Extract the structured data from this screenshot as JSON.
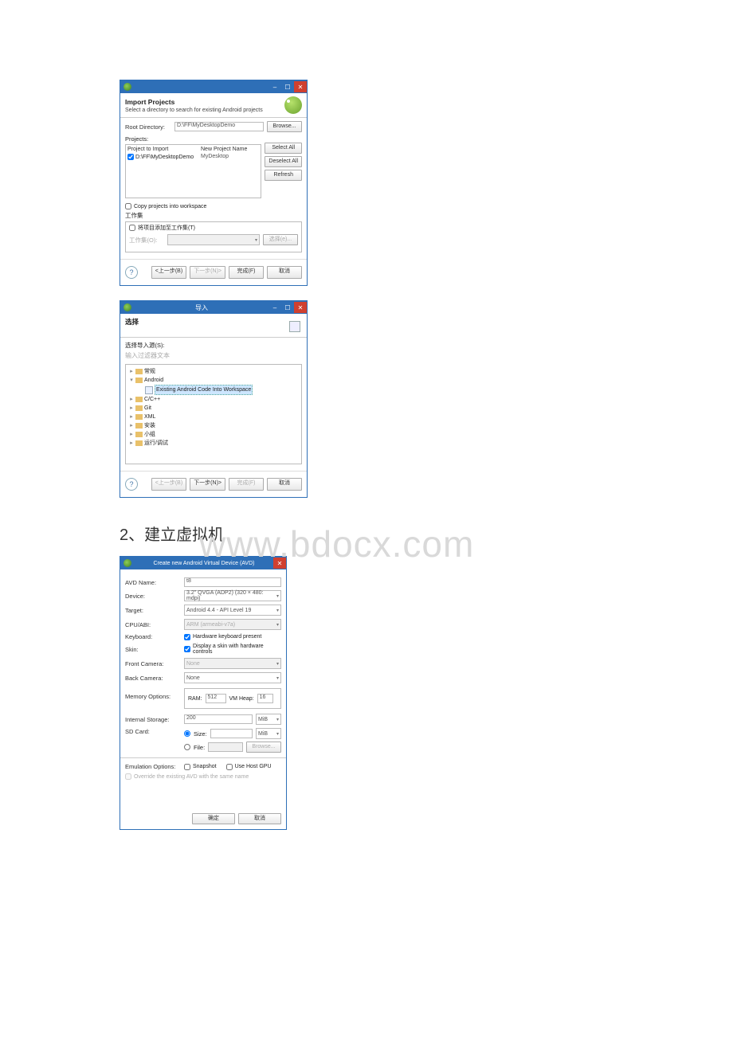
{
  "watermark": "www.bdocx.com",
  "body_text": "2、建立虚拟机",
  "win1": {
    "title": "",
    "header_title": "Import Projects",
    "header_sub": "Select a directory to search for existing Android projects",
    "root_dir_label": "Root Directory:",
    "root_dir_value": "D:\\FF\\MyDesktopDemo",
    "browse": "Browse...",
    "projects_label": "Projects:",
    "col1": "Project to Import",
    "col2": "New Project Name",
    "proj_path": "D:\\FF\\MyDesktopDemo",
    "proj_name": "MyDesktop",
    "select_all": "Select All",
    "deselect_all": "Deselect All",
    "refresh": "Refresh",
    "copy_label": "Copy projects into workspace",
    "ws_label": "工作集",
    "ws_chk": "将项目添加至工作集(T)",
    "ws_field_label": "工作集(O):",
    "ws_select_btn": "选择(e)...",
    "btn_back": "<上一步(B)",
    "btn_next": "下一步(N)>",
    "btn_finish": "完成(F)",
    "btn_cancel": "取消"
  },
  "win2": {
    "title": "导入",
    "header_title": "选择",
    "src_label": "选择导入源(S):",
    "filter_placeholder": "输入过滤器文本",
    "tree": {
      "n0": "常规",
      "n1": "Android",
      "n1a": "Existing Android Code Into Workspace",
      "n2": "C/C++",
      "n3": "Git",
      "n4": "XML",
      "n5": "安装",
      "n6": "小组",
      "n7": "运行/调试"
    },
    "btn_back": "<上一步(B)",
    "btn_next": "下一步(N)>",
    "btn_finish": "完成(F)",
    "btn_cancel": "取消"
  },
  "win3": {
    "title": "Create new Android Virtual Device (AVD)",
    "avd_name_label": "AVD Name:",
    "avd_name_value": "t8",
    "device_label": "Device:",
    "device_value": "3.2\" QVGA (ADP2) (320 × 480: mdpi)",
    "target_label": "Target:",
    "target_value": "Android 4.4 - API Level 19",
    "cpu_label": "CPU/ABI:",
    "cpu_value": "ARM (armeabi-v7a)",
    "keyboard_label": "Keyboard:",
    "keyboard_chk": "Hardware keyboard present",
    "skin_label": "Skin:",
    "skin_chk": "Display a skin with hardware controls",
    "front_cam_label": "Front Camera:",
    "front_cam_value": "None",
    "back_cam_label": "Back Camera:",
    "back_cam_value": "None",
    "mem_label": "Memory Options:",
    "ram_label": "RAM:",
    "ram_value": "512",
    "heap_label": "VM Heap:",
    "heap_value": "16",
    "storage_label": "Internal Storage:",
    "storage_value": "200",
    "storage_unit": "MiB",
    "sd_label": "SD Card:",
    "sd_size_label": "Size:",
    "sd_size_unit": "MiB",
    "sd_file_label": "File:",
    "sd_browse": "Browse...",
    "emu_label": "Emulation Options:",
    "emu_snapshot": "Snapshot",
    "emu_gpu": "Use Host GPU",
    "override": "Override the existing AVD with the same name",
    "btn_ok": "确定",
    "btn_cancel": "取消"
  }
}
